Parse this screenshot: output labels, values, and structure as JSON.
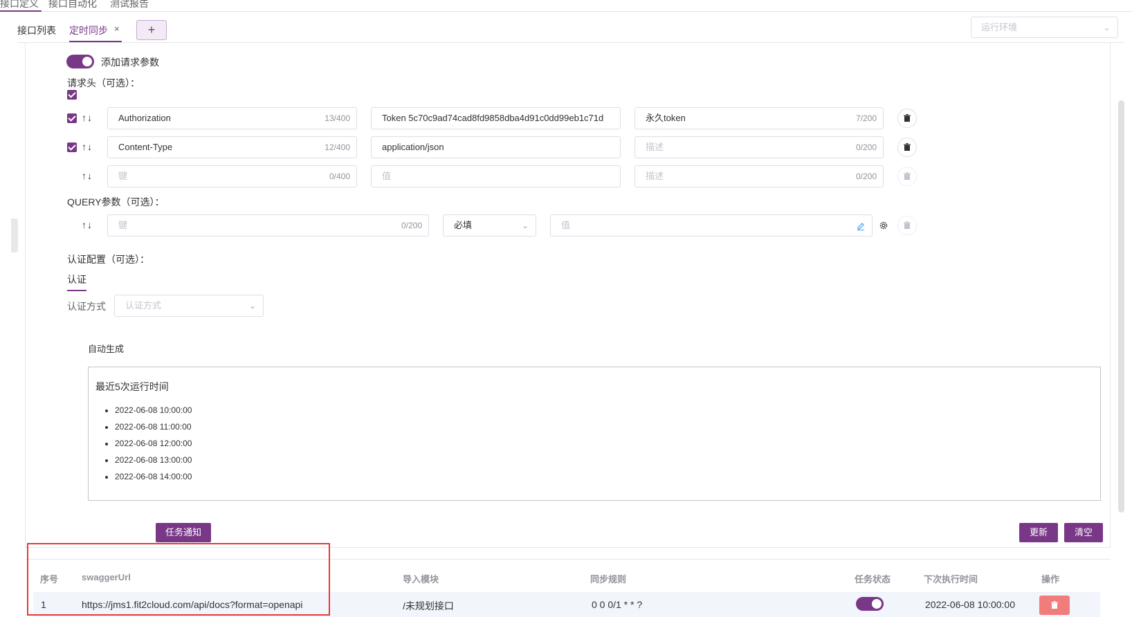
{
  "top_nav": {
    "items": [
      "接口定义",
      "接口自动化",
      "测试报告"
    ]
  },
  "tabs": {
    "items": [
      {
        "label": "接口列表",
        "active": false
      },
      {
        "label": "定时同步",
        "active": true
      }
    ],
    "close_glyph": "×",
    "add_glyph": "+"
  },
  "env_select": {
    "placeholder": "运行环境"
  },
  "form": {
    "add_params_label": "添加请求参数",
    "add_params_enabled": true,
    "headers_title": "请求头（可选）：",
    "headers": [
      {
        "checked": true,
        "key": "Authorization",
        "key_count": "13/400",
        "value": "Token 5c70c9ad74cad8fd9858dba4d91c0dd99eb1c71d",
        "desc": "永久token",
        "desc_count": "7/200"
      },
      {
        "checked": true,
        "key": "Content-Type",
        "key_count": "12/400",
        "value": "application/json",
        "desc": "",
        "desc_placeholder": "描述",
        "desc_count": "0/200"
      },
      {
        "checked": false,
        "key": "",
        "key_placeholder": "键",
        "key_count": "0/400",
        "value": "",
        "value_placeholder": "值",
        "desc": "",
        "desc_placeholder": "描述",
        "desc_count": "0/200"
      }
    ],
    "query_title": "QUERY参数（可选）：",
    "query_row": {
      "key_placeholder": "键",
      "key_count": "0/200",
      "required": "必填",
      "value_placeholder": "值"
    },
    "auth_title": "认证配置（可选）：",
    "auth_tab": "认证",
    "auth_method_label": "认证方式",
    "auth_method_placeholder": "认证方式",
    "arrows": "↑↓"
  },
  "cron": {
    "auto_generate": "自动生成",
    "runtime_title": "最近5次运行时间",
    "runtimes": [
      "2022-06-08 10:00:00",
      "2022-06-08 11:00:00",
      "2022-06-08 12:00:00",
      "2022-06-08 13:00:00",
      "2022-06-08 14:00:00"
    ]
  },
  "buttons": {
    "notify": "任务通知",
    "update": "更新",
    "clear": "清空"
  },
  "table": {
    "headers": [
      "序号",
      "swaggerUrl",
      "导入模块",
      "同步规则",
      "任务状态",
      "下次执行时间",
      "操作"
    ],
    "rows": [
      {
        "index": "1",
        "swagger_url": "https://jms1.fit2cloud.com/api/docs?format=openapi",
        "module": "/未规划接口",
        "rule": "0 0 0/1 * * ?",
        "status_enabled": true,
        "next_time": "2022-06-08 10:00:00"
      }
    ]
  },
  "colors": {
    "accent": "#783887",
    "danger": "#f07c7c",
    "highlight_box": "#e53935"
  }
}
